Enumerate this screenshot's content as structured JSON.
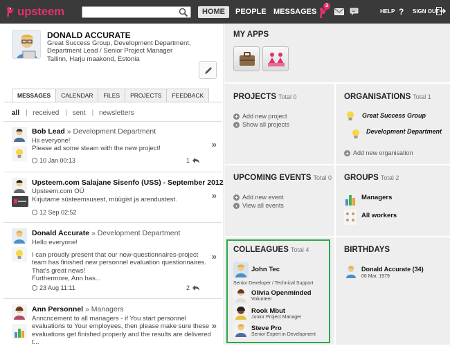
{
  "app": {
    "logo_text": "upsteem"
  },
  "topbar": {
    "search_placeholder": "",
    "nav": {
      "home": "HOME",
      "people": "PEOPLE",
      "messages": "MESSAGES"
    },
    "notification_count": "3",
    "help": "HELP",
    "help_icon": "?",
    "sign_out": "SIGN OUT",
    "colors": {
      "bar": "#3a3a3a",
      "brand": "#e0306e"
    }
  },
  "profile": {
    "name": "DONALD ACCURATE",
    "org": "Great Success Group, Development Department, Department Lead / Senior Project Manager",
    "location": "Tallinn, Harju maakond, Estonia"
  },
  "tabs": [
    "MESSAGES",
    "CALENDAR",
    "FILES",
    "PROJECTS",
    "FEEDBACK"
  ],
  "filters": [
    "all",
    "received",
    "sent",
    "newsletters"
  ],
  "messages": [
    {
      "author": "Bob Lead",
      "group": "» Development Department",
      "body": "Hii everyone!\nPlease ad some steam with the new project!",
      "time": "10 Jan 00:13",
      "replies": "1"
    },
    {
      "author": "Upsteem.com Salajane Sisenfo (USS) - September 2012",
      "subtitle": "Upsteem.com OÜ",
      "body": "Kirjutame süsteemsusest, müügist ja arendustest.",
      "time": "12 Sep 02:52"
    },
    {
      "author": "Donald Accurate",
      "group": "» Development Department",
      "subtitle": "Hello everyone!",
      "body": "I can proudly present that our new-questionnaires-project team has finished new personnel evaluation questionnaires.\nThat's great news!\nFurthermore, Ann has...",
      "time": "23 Aug 11:11",
      "replies": "2"
    },
    {
      "author": "Ann Personnel",
      "group": "» Managers",
      "body": "Anncncement to all managers - if You start personnel evaluations to Your employees, then please make sure these evaluations get finished properly and the results are delivered t..."
    }
  ],
  "my_apps": {
    "title": "MY APPS"
  },
  "projects": {
    "title": "PROJECTS",
    "total": "Total 0",
    "links": [
      "Add new project",
      "Show all projects"
    ]
  },
  "organisations": {
    "title": "ORGANISATIONS",
    "total": "Total 1",
    "items": [
      "Great Success Group",
      "Development Department"
    ],
    "add": "Add new organisation"
  },
  "events": {
    "title": "UPCOMING EVENTS",
    "total": "Total 0",
    "links": [
      "Add new event",
      "View all events"
    ]
  },
  "groups": {
    "title": "GROUPS",
    "total": "Total 2",
    "items": [
      "Managers",
      "All workers"
    ]
  },
  "colleagues": {
    "title": "COLLEAGUES",
    "total": "Total 4",
    "items": [
      {
        "name": "John Tec",
        "role": "Senior Developer / Technical Support"
      },
      {
        "name": "Olivia Openminded",
        "role": "Volunteer"
      },
      {
        "name": "Rook Mbut",
        "role": "Junior Project Manager"
      },
      {
        "name": "Steve Pro",
        "role": "Senior Expert in Development"
      }
    ],
    "highlight_color": "#2ca84a"
  },
  "birthdays": {
    "title": "BIRTHDAYS",
    "items": [
      {
        "name": "Donald Accurate (34)",
        "date": "06 Mar, 1979"
      }
    ]
  }
}
